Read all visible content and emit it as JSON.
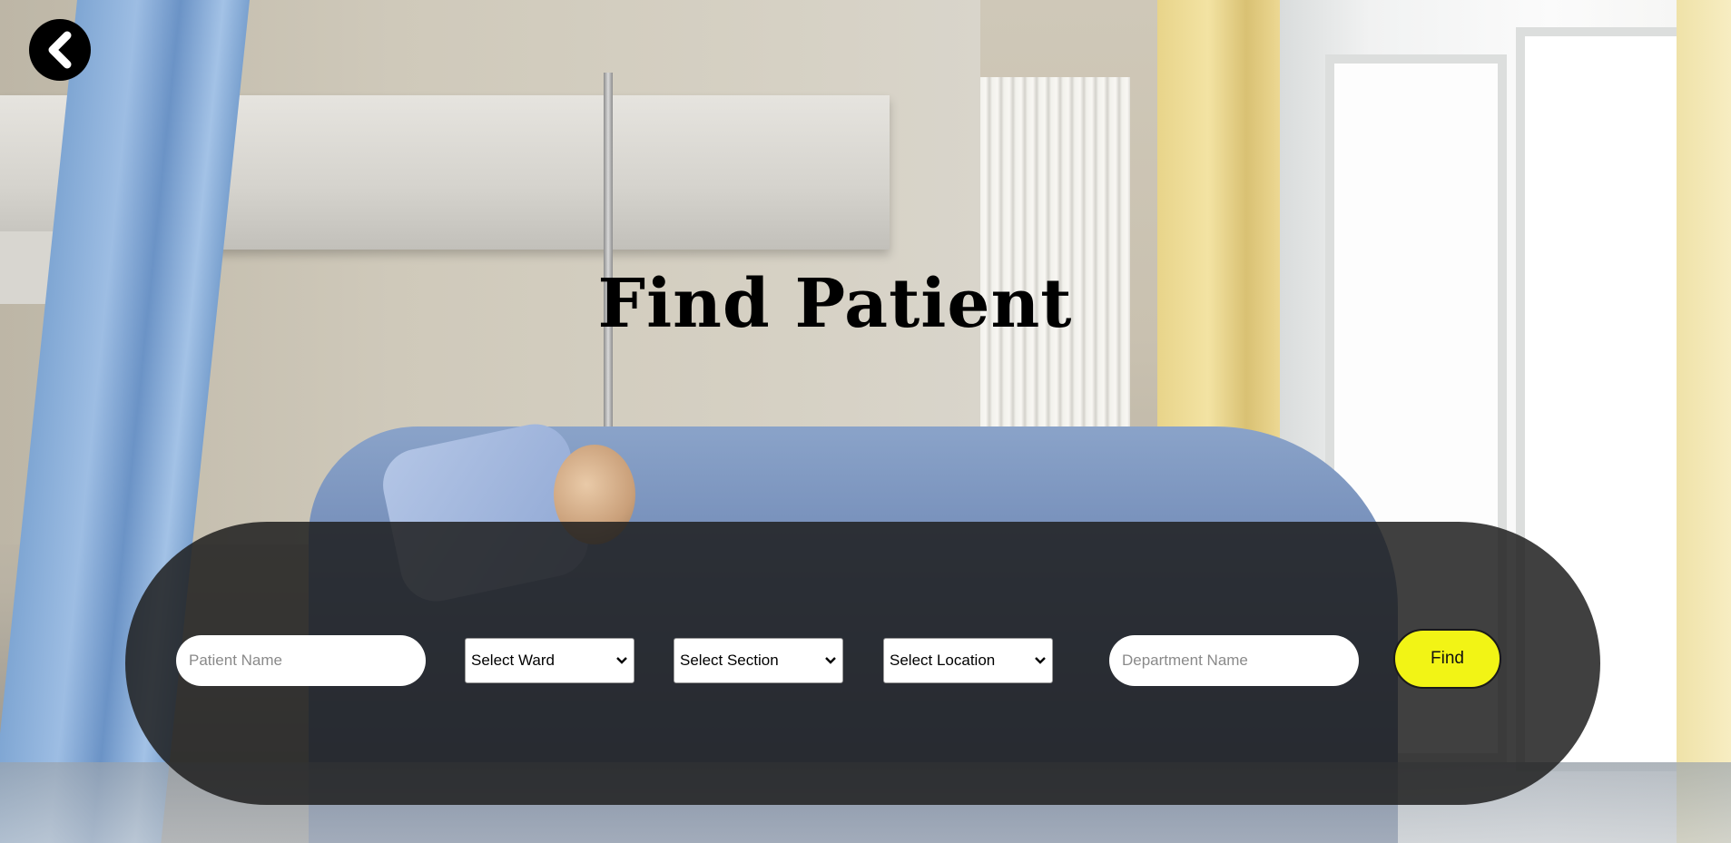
{
  "page": {
    "title": "Find Patient"
  },
  "nav": {
    "back_icon": "chevron-left-icon"
  },
  "form": {
    "patient_name_placeholder": "Patient Name",
    "ward_label": "Select Ward",
    "section_label": "Select Section",
    "location_label": "Select Location",
    "department_name_placeholder": "Department Name",
    "find_label": "Find"
  },
  "colors": {
    "accent": "#f2f415",
    "band": "#1e1e1e",
    "title": "#000000"
  }
}
